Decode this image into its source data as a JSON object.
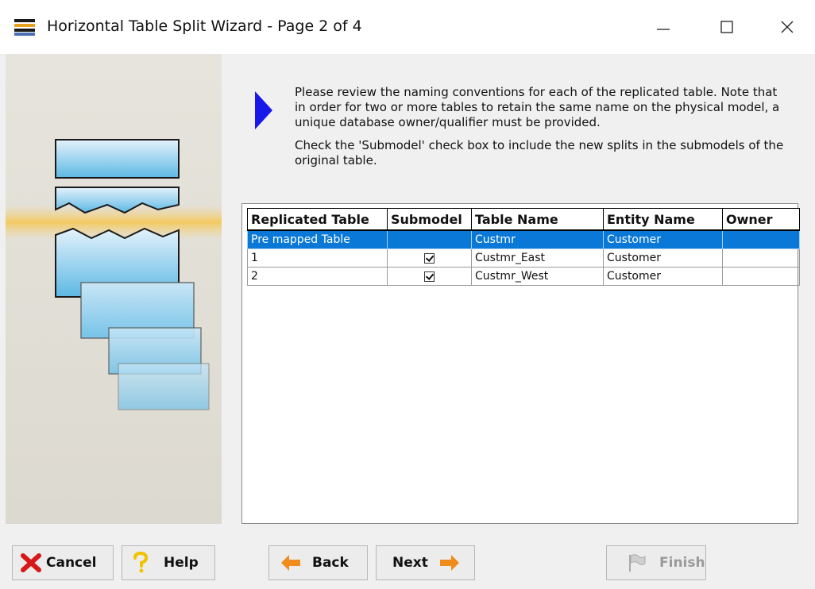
{
  "window": {
    "title": "Horizontal Table Split Wizard - Page 2 of 4",
    "minimize_icon": "minimize-icon",
    "maximize_icon": "maximize-icon",
    "close_icon": "close-icon"
  },
  "instructions": {
    "paragraph1": "Please review the naming conventions for each of the replicated table. Note that in order for two or more tables to retain the same name on the physical model, a unique database owner/qualifier must be provided.",
    "paragraph2": "Check the 'Submodel' check box to include the new splits in the submodels of the original table."
  },
  "grid": {
    "columns": [
      "Replicated Table",
      "Submodel",
      "Table Name",
      "Entity Name",
      "Owner"
    ],
    "rows": [
      {
        "replicated": "Pre mapped Table",
        "submodel": false,
        "table_name": "Custmr",
        "entity_name": "Customer",
        "owner": "",
        "selected": true
      },
      {
        "replicated": "1",
        "submodel": true,
        "table_name": "Custmr_East",
        "entity_name": "Customer",
        "owner": "",
        "selected": false
      },
      {
        "replicated": "2",
        "submodel": true,
        "table_name": "Custmr_West",
        "entity_name": "Customer",
        "owner": "",
        "selected": false
      }
    ],
    "selection_color": "#0a78d7"
  },
  "buttons": {
    "cancel": "Cancel",
    "help": "Help",
    "back": "Back",
    "next": "Next",
    "finish": "Finish"
  },
  "colors": {
    "accent_arrow": "#1818e8",
    "cancel_x": "#d81818",
    "nav_arrow": "#f08c1c"
  }
}
